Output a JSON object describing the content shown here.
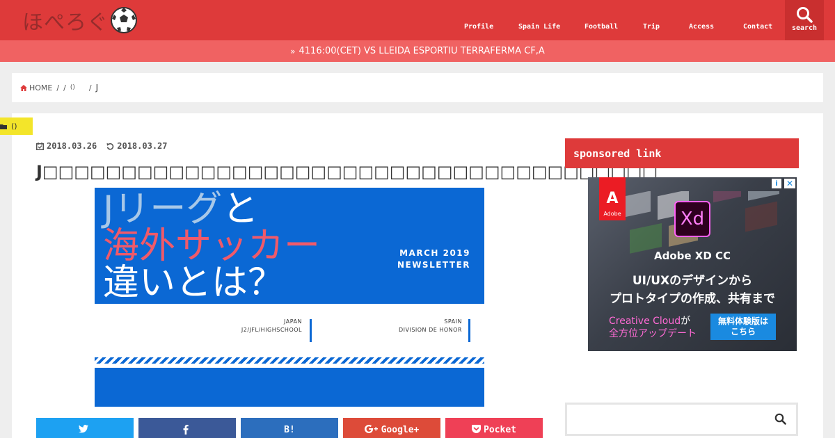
{
  "header": {
    "logo_text": "ほぺろぐ",
    "nav": [
      {
        "label": "Profile"
      },
      {
        "label": "Spain Life"
      },
      {
        "label": "Football"
      },
      {
        "label": "Trip"
      },
      {
        "label": "Access"
      },
      {
        "label": "Contact"
      }
    ],
    "search_label": "search"
  },
  "ticker": {
    "text": "4116:00(CET) VS LLEIDA ESPORTIU TERRAFERMA CF,A"
  },
  "breadcrumb": {
    "home": "HOME",
    "sep": "/",
    "item2": "()",
    "last": "J"
  },
  "article": {
    "category": "()",
    "published": "2018.03.26",
    "updated": "2018.03.27",
    "title": "J□□□□□□□□□□□□□□□□□□□□□□□□□□□□□□□□□□□□□□□",
    "eyecatch": {
      "line1_a": "Jリーグ",
      "line1_b": "と",
      "line2": "海外サッカー",
      "line3": "違いとは？",
      "newsletter_1": "MARCH 2019",
      "newsletter_2": "NEWSLETTER",
      "left_1": "JAPAN",
      "left_2": "J2/JFL/HIGHSCHOOL",
      "right_1": "SPAIN",
      "right_2": "DIVISION DE HONOR"
    },
    "share": [
      {
        "label": "",
        "color": "#1da1f2"
      },
      {
        "label": "",
        "color": "#3b5998"
      },
      {
        "label": "B!",
        "color": "#2c6ebd"
      },
      {
        "label": "Google+",
        "color": "#dd4b39"
      },
      {
        "label": "Pocket",
        "color": "#ef4056"
      }
    ]
  },
  "sidebar": {
    "sponsored_title": "sponsored link",
    "ad": {
      "brand": "Adobe",
      "tile": "Xd",
      "headline": "Adobe XD CC",
      "line2": "UI/UXのデザインから",
      "line3": "プロトタイプの作成、共有まで",
      "cc_1": "Creative Cloud",
      "cc_1b": "が",
      "cc_2": "全方位アップデート",
      "btn_1": "無料体験版は",
      "btn_2": "こちら",
      "info": "i",
      "close": "✕"
    },
    "search_placeholder": ""
  },
  "colors": {
    "header": "#de3a3a",
    "ticker": "#f06262",
    "accent_blue": "#0b68d4",
    "category": "#f3e52a"
  }
}
